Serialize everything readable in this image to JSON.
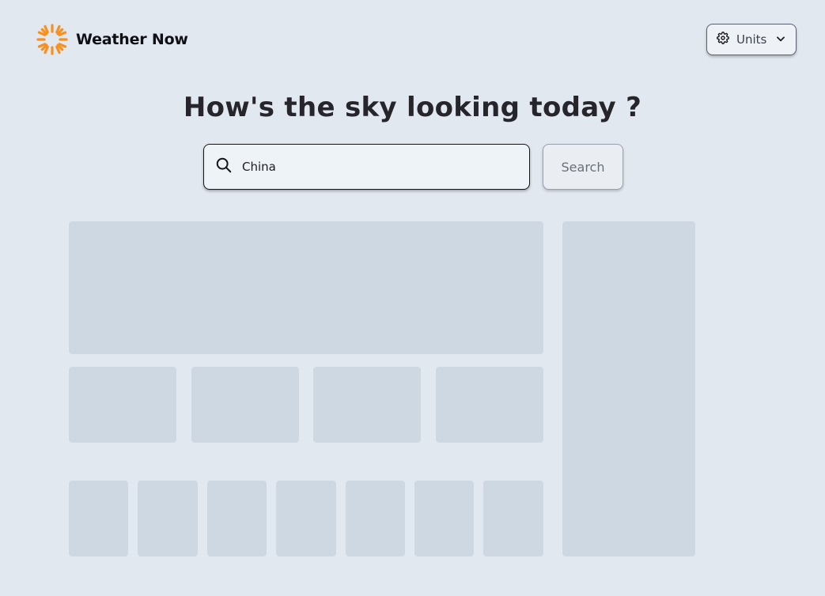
{
  "app": {
    "name": "Weather Now",
    "logo_icon": "sun-icon",
    "accent_color": "#f7901e"
  },
  "header": {
    "units_label": "Units",
    "units_icon": "gear-icon",
    "dropdown_icon": "chevron-down-icon"
  },
  "hero": {
    "title": "How's the sky looking today ?"
  },
  "search": {
    "value": "China",
    "icon": "search-icon",
    "button_label": "Search"
  },
  "colors": {
    "background": "#e2e8f0",
    "skeleton": "#cdd8e3"
  }
}
